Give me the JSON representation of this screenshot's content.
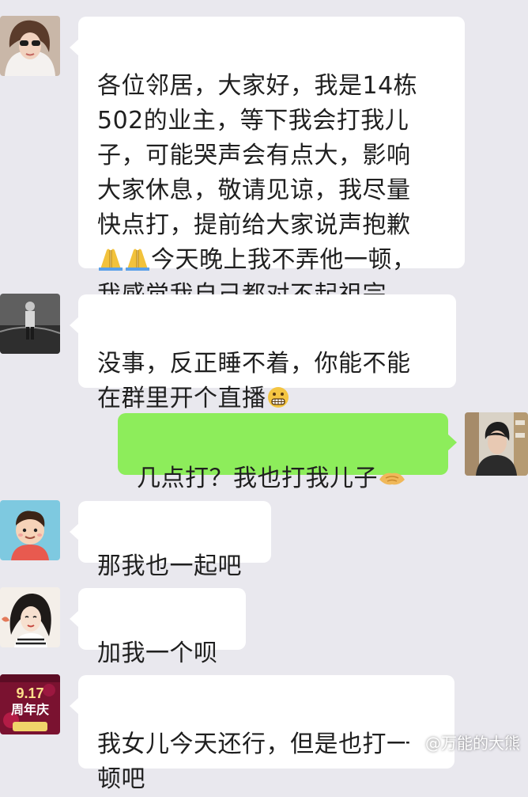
{
  "messages": [
    {
      "side": "left",
      "text_a": "各位邻居，大家好，我是14栋\n502的业主，等下我会打我儿\n子，可能哭声会有点大，影响\n大家休息，敬请见谅，我尽量\n快点打，提前给大家说声抱歉\n",
      "emoji": "pray-emoji",
      "text_b": "今天晚上我不弄他一顿，\n我感觉我自己都对不起祖宗，"
    },
    {
      "side": "left",
      "text_a": "没事，反正睡不着，你能不能\n在群里开个直播",
      "emoji": "grimace-emoji"
    },
    {
      "side": "right",
      "text_a": "几点打？我也打我儿子",
      "emoji": "shake-hands-emoji"
    },
    {
      "side": "left",
      "text_a": "那我也一起吧"
    },
    {
      "side": "left",
      "text_a": "加我一个呗"
    },
    {
      "side": "left",
      "text_a": "我女儿今天还行，但是也打一\n顿吧"
    }
  ],
  "avatar_badge": {
    "line1": "9.17",
    "line2": "周年庆"
  },
  "watermark": {
    "text": "@万能的大熊",
    "icon": "weibo-icon"
  },
  "colors": {
    "background": "#e9e8ee",
    "bubble_left": "#ffffff",
    "bubble_right": "#8ded5b"
  }
}
